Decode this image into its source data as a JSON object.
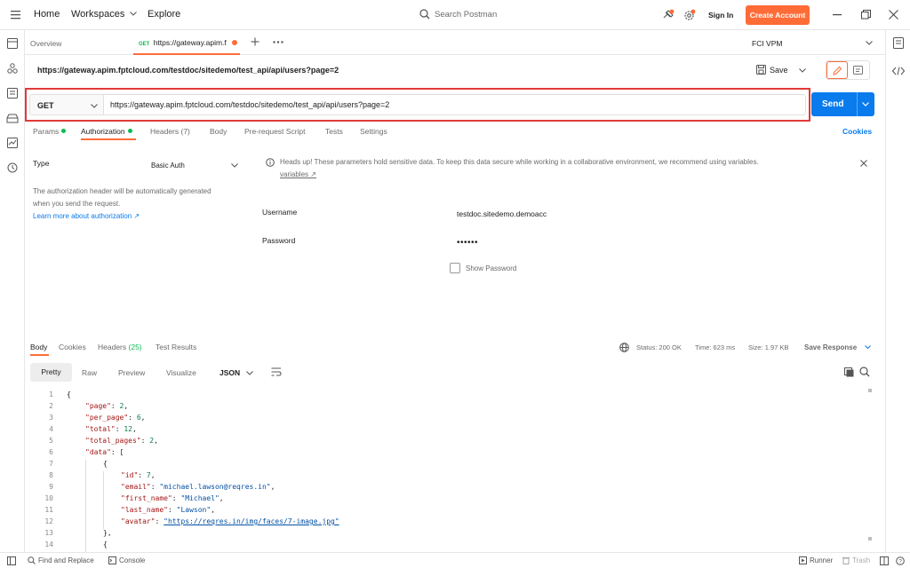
{
  "topbar": {
    "home": "Home",
    "workspaces": "Workspaces",
    "explore": "Explore",
    "search_placeholder": "Search Postman",
    "sign_in": "Sign In",
    "create_account": "Create Account"
  },
  "tabs": {
    "overview": "Overview",
    "active_method": "GET",
    "active_title": "https://gateway.apim.f",
    "environment": "FCI VPM"
  },
  "request": {
    "title": "https://gateway.apim.fptcloud.com/testdoc/sitedemo/test_api/api/users?page=2",
    "save": "Save",
    "method": "GET",
    "url": "https://gateway.apim.fptcloud.com/testdoc/sitedemo/test_api/api/users?page=2",
    "send": "Send"
  },
  "request_tabs": {
    "params": "Params",
    "authorization": "Authorization",
    "headers": "Headers (7)",
    "body": "Body",
    "prerequest": "Pre-request Script",
    "tests": "Tests",
    "settings": "Settings",
    "cookies": "Cookies"
  },
  "auth": {
    "type_label": "Type",
    "type_value": "Basic Auth",
    "description_1": "The authorization header will be automatically generated",
    "description_2": "when you send the request.",
    "learn_more": "Learn more about authorization ↗",
    "notice": "Heads up! These parameters hold sensitive data. To keep this data secure while working in a collaborative environment, we recommend using variables.",
    "notice_link": "variables ↗",
    "username_label": "Username",
    "username_value": "testdoc.sitedemo.demoacc",
    "password_label": "Password",
    "password_value": "••••••",
    "show_password": "Show Password"
  },
  "response_tabs": {
    "body": "Body",
    "cookies": "Cookies",
    "headers": "Headers",
    "headers_count": "(25)",
    "test_results": "Test Results"
  },
  "response_meta": {
    "status": "Status: 200 OK",
    "time": "Time: 623 ms",
    "size": "Size: 1.97 KB",
    "save_response": "Save Response"
  },
  "view_modes": {
    "pretty": "Pretty",
    "raw": "Raw",
    "preview": "Preview",
    "visualize": "Visualize",
    "format": "JSON"
  },
  "code": {
    "line_numbers": [
      "1",
      "2",
      "3",
      "4",
      "5",
      "6",
      "7",
      "8",
      "9",
      "10",
      "11",
      "12",
      "13",
      "14"
    ],
    "l2_key": "\"page\"",
    "l2_val": "2",
    "l3_key": "\"per_page\"",
    "l3_val": "6",
    "l4_key": "\"total\"",
    "l4_val": "12",
    "l5_key": "\"total_pages\"",
    "l5_val": "2",
    "l6_key": "\"data\"",
    "l8_key": "\"id\"",
    "l8_val": "7",
    "l9_key": "\"email\"",
    "l9_val": "\"michael.lawson@reqres.in\"",
    "l10_key": "\"first_name\"",
    "l10_val": "\"Michael\"",
    "l11_key": "\"last_name\"",
    "l11_val": "\"Lawson\"",
    "l12_key": "\"avatar\"",
    "l12_val": "\"https://reqres.in/img/faces/7-image.jpg\""
  },
  "statusbar": {
    "find_replace": "Find and Replace",
    "console": "Console",
    "runner": "Runner",
    "trash": "Trash"
  }
}
